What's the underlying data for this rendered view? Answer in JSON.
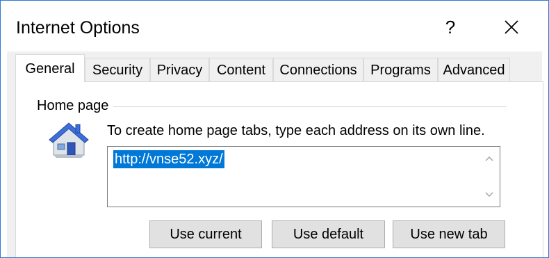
{
  "window": {
    "title": "Internet Options",
    "help_label": "?",
    "icons": {
      "help": "help-icon",
      "close": "close-icon"
    }
  },
  "tabs": [
    {
      "label": "General",
      "active": true
    },
    {
      "label": "Security",
      "active": false
    },
    {
      "label": "Privacy",
      "active": false
    },
    {
      "label": "Content",
      "active": false
    },
    {
      "label": "Connections",
      "active": false
    },
    {
      "label": "Programs",
      "active": false
    },
    {
      "label": "Advanced",
      "active": false
    }
  ],
  "home_page": {
    "section_label": "Home page",
    "icon": "house-icon",
    "instruction": "To create home page tabs, type each address on its own line.",
    "url_value": "http://vnse52.xyz/",
    "buttons": {
      "use_current": "Use current",
      "use_default": "Use default",
      "use_new_tab": "Use new tab"
    }
  },
  "colors": {
    "accent": "#0078d7",
    "frame_border": "#2b7bd3",
    "client_bg": "#f0f0f0",
    "button_bg": "#e1e1e1"
  }
}
